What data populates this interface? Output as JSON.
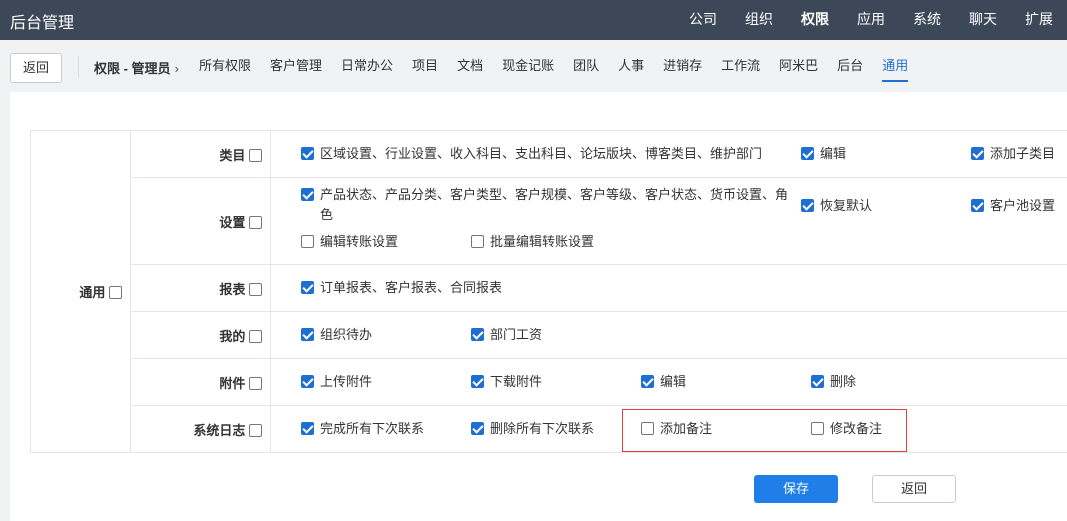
{
  "app": {
    "title": "后台管理"
  },
  "topnav": [
    {
      "label": "公司",
      "active": false
    },
    {
      "label": "组织",
      "active": false
    },
    {
      "label": "权限",
      "active": true
    },
    {
      "label": "应用",
      "active": false
    },
    {
      "label": "系统",
      "active": false
    },
    {
      "label": "聊天",
      "active": false
    },
    {
      "label": "扩展",
      "active": false
    }
  ],
  "subbar": {
    "back_label": "返回",
    "breadcrumb": "权限 - 管理员",
    "tabs": [
      {
        "label": "所有权限",
        "active": false
      },
      {
        "label": "客户管理",
        "active": false
      },
      {
        "label": "日常办公",
        "active": false
      },
      {
        "label": "项目",
        "active": false
      },
      {
        "label": "文档",
        "active": false
      },
      {
        "label": "现金记账",
        "active": false
      },
      {
        "label": "团队",
        "active": false
      },
      {
        "label": "人事",
        "active": false
      },
      {
        "label": "进销存",
        "active": false
      },
      {
        "label": "工作流",
        "active": false
      },
      {
        "label": "阿米巴",
        "active": false
      },
      {
        "label": "后台",
        "active": false
      },
      {
        "label": "通用",
        "active": true
      }
    ]
  },
  "permissions": {
    "group": {
      "label": "通用",
      "checked": false
    },
    "rows": [
      {
        "label": "类目",
        "checked": false,
        "items": [
          {
            "label": "区域设置、行业设置、收入科目、支出科目、论坛版块、博客类目、维护部门",
            "checked": true
          },
          {
            "label": "编辑",
            "checked": true
          },
          {
            "label": "添加子类目",
            "checked": true
          }
        ]
      },
      {
        "label": "设置",
        "checked": false,
        "items": [
          {
            "label": "产品状态、产品分类、客户类型、客户规模、客户等级、客户状态、货币设置、角色",
            "checked": true
          },
          {
            "label": "恢复默认",
            "checked": true
          },
          {
            "label": "客户池设置",
            "checked": true
          },
          {
            "label": "编辑转账设置",
            "checked": false
          },
          {
            "label": "批量编辑转账设置",
            "checked": false
          }
        ]
      },
      {
        "label": "报表",
        "checked": false,
        "items": [
          {
            "label": "订单报表、客户报表、合同报表",
            "checked": true
          }
        ]
      },
      {
        "label": "我的",
        "checked": false,
        "items": [
          {
            "label": "组织待办",
            "checked": true
          },
          {
            "label": "部门工资",
            "checked": true
          }
        ]
      },
      {
        "label": "附件",
        "checked": false,
        "items": [
          {
            "label": "上传附件",
            "checked": true
          },
          {
            "label": "下载附件",
            "checked": true
          },
          {
            "label": "编辑",
            "checked": true
          },
          {
            "label": "删除",
            "checked": true
          }
        ]
      },
      {
        "label": "系统日志",
        "checked": false,
        "items": [
          {
            "label": "完成所有下次联系",
            "checked": true
          },
          {
            "label": "删除所有下次联系",
            "checked": true
          },
          {
            "label": "添加备注",
            "checked": false
          },
          {
            "label": "修改备注",
            "checked": false
          }
        ]
      }
    ]
  },
  "actions": {
    "save_label": "保存",
    "return_label": "返回"
  }
}
